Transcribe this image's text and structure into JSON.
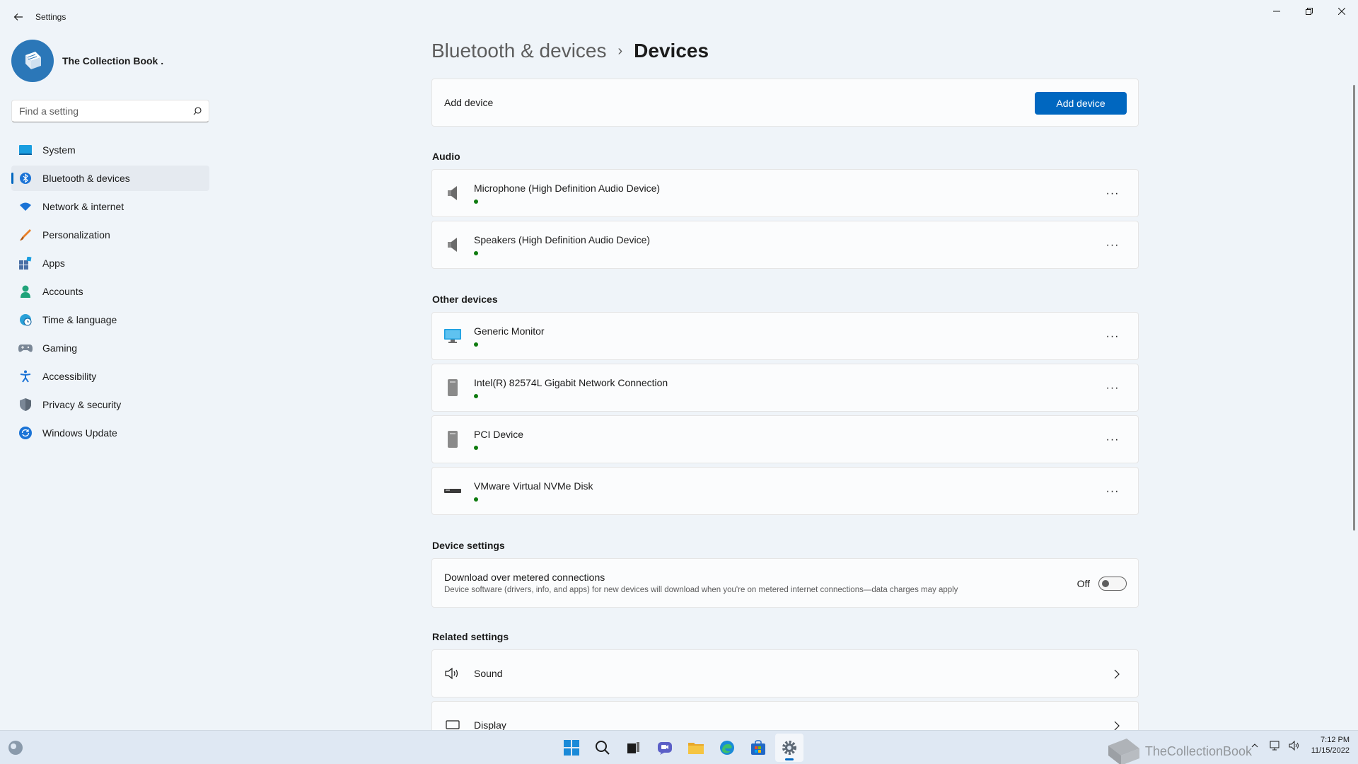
{
  "window": {
    "title": "Settings"
  },
  "profile": {
    "name": "The Collection Book ."
  },
  "search": {
    "placeholder": "Find a setting"
  },
  "sidebar": {
    "items": [
      {
        "label": "System",
        "icon": "system-icon"
      },
      {
        "label": "Bluetooth & devices",
        "icon": "bluetooth-icon",
        "active": true
      },
      {
        "label": "Network & internet",
        "icon": "wifi-icon"
      },
      {
        "label": "Personalization",
        "icon": "brush-icon"
      },
      {
        "label": "Apps",
        "icon": "apps-icon"
      },
      {
        "label": "Accounts",
        "icon": "person-icon"
      },
      {
        "label": "Time & language",
        "icon": "clock-globe-icon"
      },
      {
        "label": "Gaming",
        "icon": "gamepad-icon"
      },
      {
        "label": "Accessibility",
        "icon": "accessibility-icon"
      },
      {
        "label": "Privacy & security",
        "icon": "shield-icon"
      },
      {
        "label": "Windows Update",
        "icon": "update-icon"
      }
    ]
  },
  "breadcrumb": {
    "parent": "Bluetooth & devices",
    "separator": "›",
    "current": "Devices"
  },
  "add_device": {
    "label": "Add device",
    "button": "Add device"
  },
  "audio": {
    "title": "Audio",
    "devices": [
      {
        "name": "Microphone (High Definition Audio Device)",
        "icon": "speaker-icon"
      },
      {
        "name": "Speakers (High Definition Audio Device)",
        "icon": "speaker-icon"
      }
    ]
  },
  "other": {
    "title": "Other devices",
    "devices": [
      {
        "name": "Generic Monitor",
        "icon": "monitor-icon"
      },
      {
        "name": "Intel(R) 82574L Gigabit Network Connection",
        "icon": "tower-icon"
      },
      {
        "name": "PCI Device",
        "icon": "tower-icon"
      },
      {
        "name": "VMware Virtual NVMe Disk",
        "icon": "disk-icon"
      }
    ]
  },
  "device_settings": {
    "title": "Device settings",
    "metered": {
      "title": "Download over metered connections",
      "description": "Device software (drivers, info, and apps) for new devices will download when you're on metered internet connections—data charges may apply",
      "state": "Off"
    }
  },
  "related": {
    "title": "Related settings",
    "items": [
      {
        "label": "Sound",
        "icon": "sound-icon"
      },
      {
        "label": "Display",
        "icon": "display-icon"
      }
    ]
  },
  "more_label": "···",
  "taskbar": {
    "clock_time": "7:12 PM",
    "clock_date": "11/15/2022",
    "watermark": "TheCollectionBook"
  },
  "colors": {
    "accent": "#0067c0",
    "status_ok": "#0f7b0f"
  }
}
